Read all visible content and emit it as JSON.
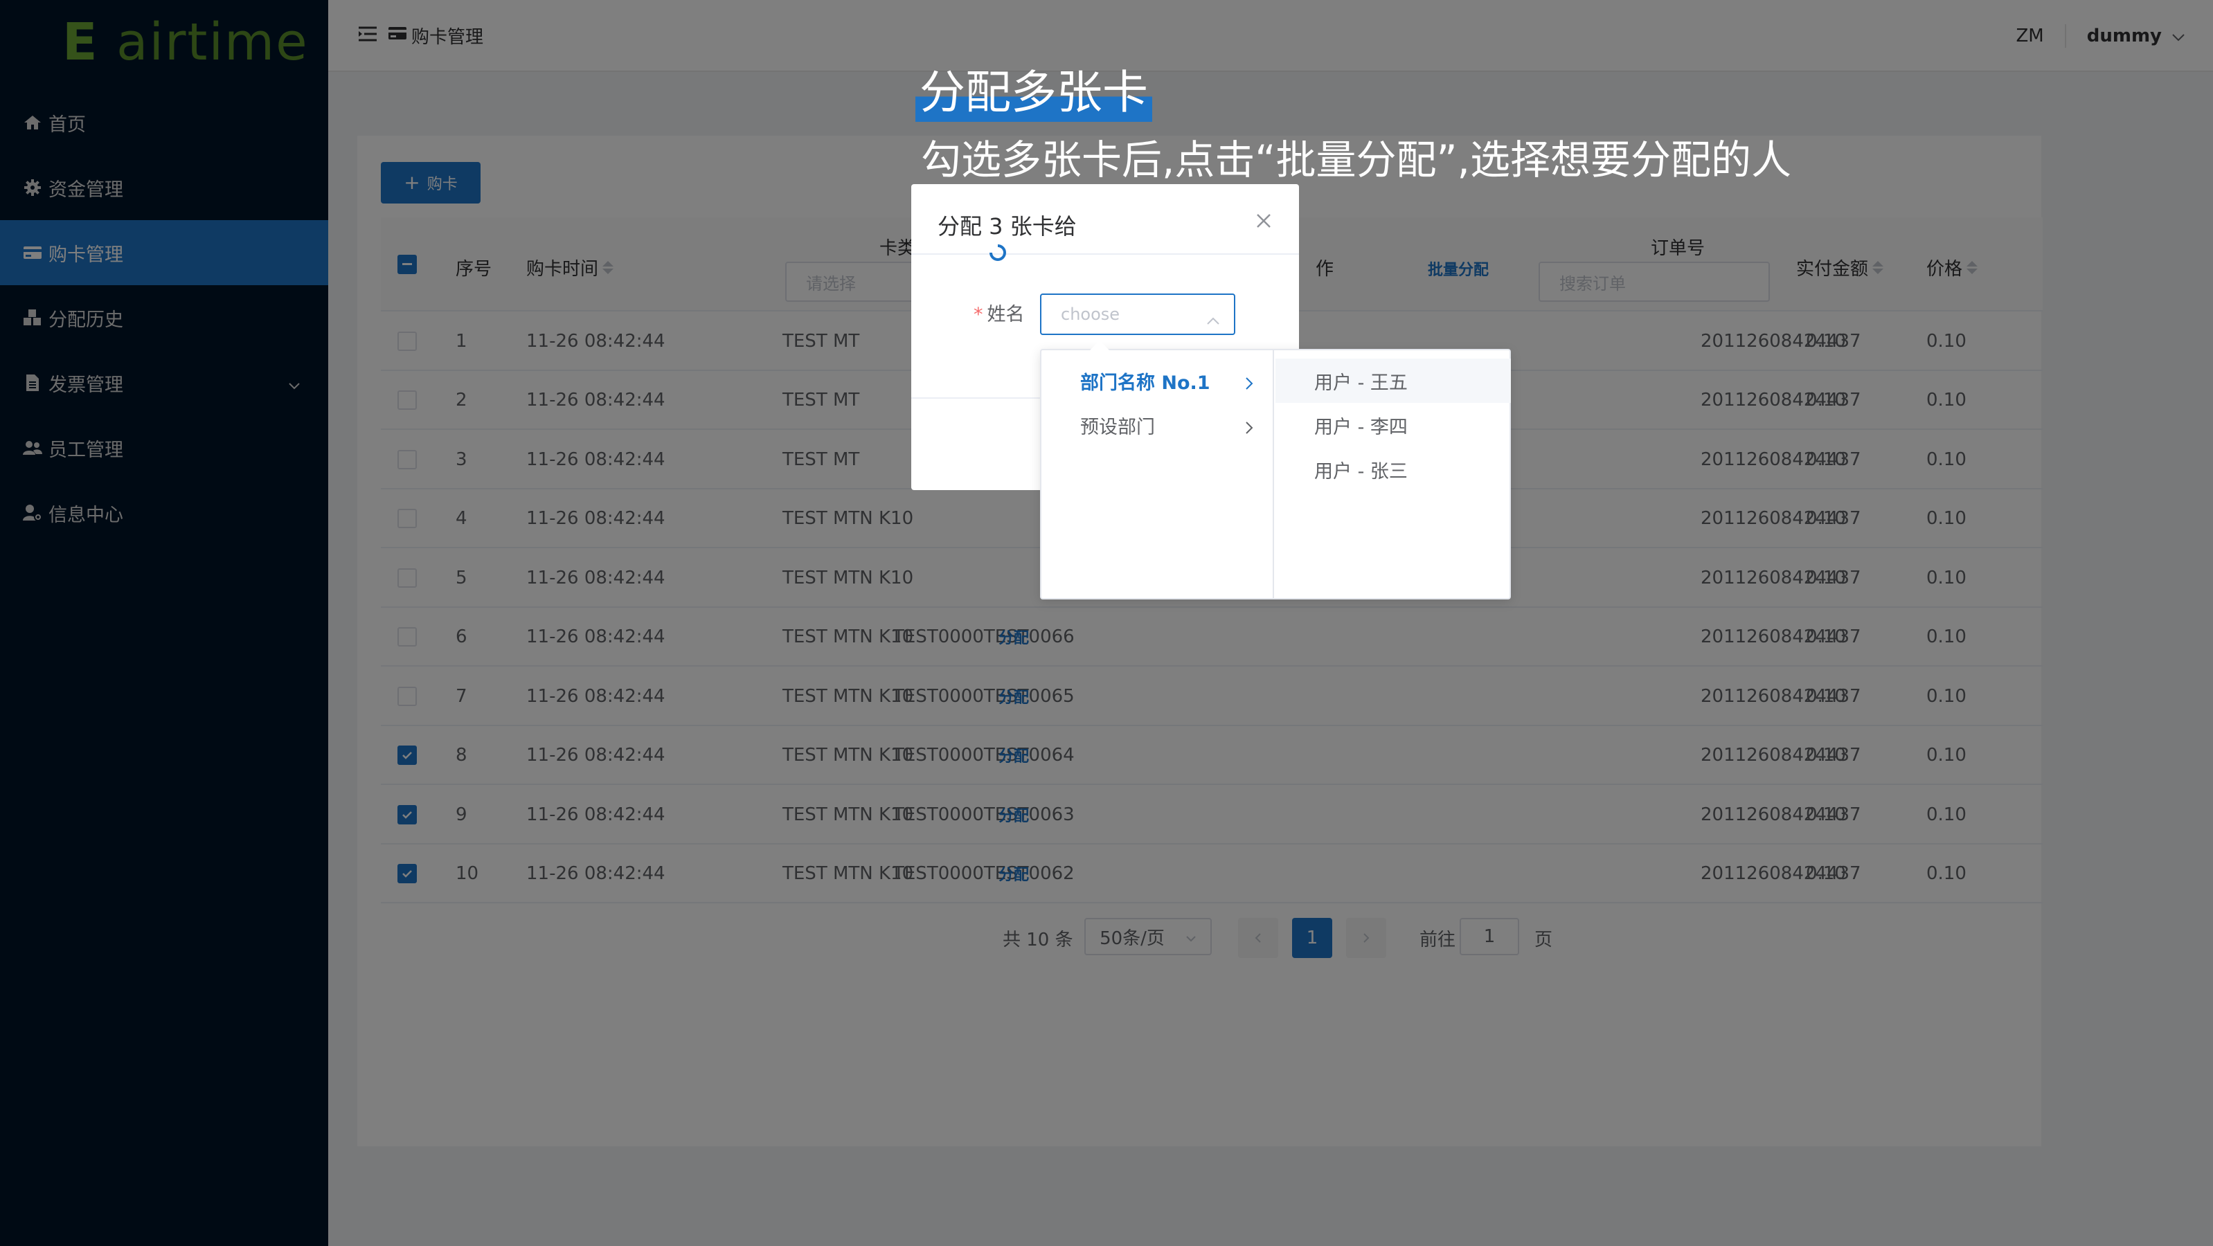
{
  "app": {
    "logo_letter": "E",
    "logo_text": "airtime"
  },
  "sidebar": {
    "items": [
      {
        "label": "首页",
        "icon": "home-icon"
      },
      {
        "label": "资金管理",
        "icon": "gear-icon"
      },
      {
        "label": "购卡管理",
        "icon": "card-icon",
        "active": true
      },
      {
        "label": "分配历史",
        "icon": "cubes-icon"
      },
      {
        "label": "发票管理",
        "icon": "document-icon"
      },
      {
        "label": "员工管理",
        "icon": "users-icon"
      },
      {
        "label": "信息中心",
        "icon": "user-settings-icon"
      }
    ]
  },
  "header": {
    "breadcrumb": "购卡管理",
    "initials": "ZM",
    "username": "dummy"
  },
  "toolbar": {
    "buy_label": "购卡"
  },
  "table": {
    "columns": {
      "index": "序号",
      "time": "购卡时间",
      "card_type": "卡类",
      "action": "作",
      "batch_assign": "批量分配",
      "order_no": "订单号",
      "paid": "实付金额",
      "price": "价格"
    },
    "filters": {
      "card_type_placeholder": "请选择",
      "order_placeholder": "搜索订单"
    },
    "assign_link": "分配",
    "rows": [
      {
        "no": "1",
        "time": "11-26 08:42:44",
        "type": "TEST MT",
        "serial": "",
        "order": "20112608424437",
        "paid": "0.10",
        "price": "0.10",
        "checked": false
      },
      {
        "no": "2",
        "time": "11-26 08:42:44",
        "type": "TEST MT",
        "serial": "",
        "order": "20112608424437",
        "paid": "0.10",
        "price": "0.10",
        "checked": false
      },
      {
        "no": "3",
        "time": "11-26 08:42:44",
        "type": "TEST MT",
        "serial": "",
        "order": "20112608424437",
        "paid": "0.10",
        "price": "0.10",
        "checked": false
      },
      {
        "no": "4",
        "time": "11-26 08:42:44",
        "type": "TEST MTN K10",
        "serial": "",
        "order": "20112608424437",
        "paid": "0.10",
        "price": "0.10",
        "checked": false
      },
      {
        "no": "5",
        "time": "11-26 08:42:44",
        "type": "TEST MTN K10",
        "serial": "",
        "order": "20112608424437",
        "paid": "0.10",
        "price": "0.10",
        "checked": false
      },
      {
        "no": "6",
        "time": "11-26 08:42:44",
        "type": "TEST MTN K10",
        "serial": "TEST0000TEST0066",
        "order": "20112608424437",
        "paid": "0.10",
        "price": "0.10",
        "checked": false
      },
      {
        "no": "7",
        "time": "11-26 08:42:44",
        "type": "TEST MTN K10",
        "serial": "TEST0000TEST0065",
        "order": "20112608424437",
        "paid": "0.10",
        "price": "0.10",
        "checked": false
      },
      {
        "no": "8",
        "time": "11-26 08:42:44",
        "type": "TEST MTN K10",
        "serial": "TEST0000TEST0064",
        "order": "20112608424437",
        "paid": "0.10",
        "price": "0.10",
        "checked": true
      },
      {
        "no": "9",
        "time": "11-26 08:42:44",
        "type": "TEST MTN K10",
        "serial": "TEST0000TEST0063",
        "order": "20112608424437",
        "paid": "0.10",
        "price": "0.10",
        "checked": true
      },
      {
        "no": "10",
        "time": "11-26 08:42:44",
        "type": "TEST MTN K10",
        "serial": "TEST0000TEST0062",
        "order": "20112608424437",
        "paid": "0.10",
        "price": "0.10",
        "checked": true
      }
    ]
  },
  "pagination": {
    "total": "共 10 条",
    "page_size": "50条/页",
    "current": "1",
    "goto_label": "前往",
    "goto_value": "1",
    "page_suffix": "页"
  },
  "tutorial": {
    "title": "分配多张卡",
    "description": "勾选多张卡后,点击“批量分配”,选择想要分配的人"
  },
  "dialog": {
    "title": "分配 3 张卡给",
    "name_label": "姓名",
    "select_placeholder": "choose"
  },
  "cascader": {
    "departments": [
      {
        "label": "部门名称 No.1",
        "selected": true
      },
      {
        "label": "预设部门",
        "selected": false
      }
    ],
    "users": [
      {
        "label": "用户 - 王五"
      },
      {
        "label": "用户 - 李四"
      },
      {
        "label": "用户 - 张三"
      }
    ]
  },
  "colors": {
    "sidebar_bg": "#001529",
    "accent": "#1e74c6",
    "logo_green": "#6aa534"
  }
}
